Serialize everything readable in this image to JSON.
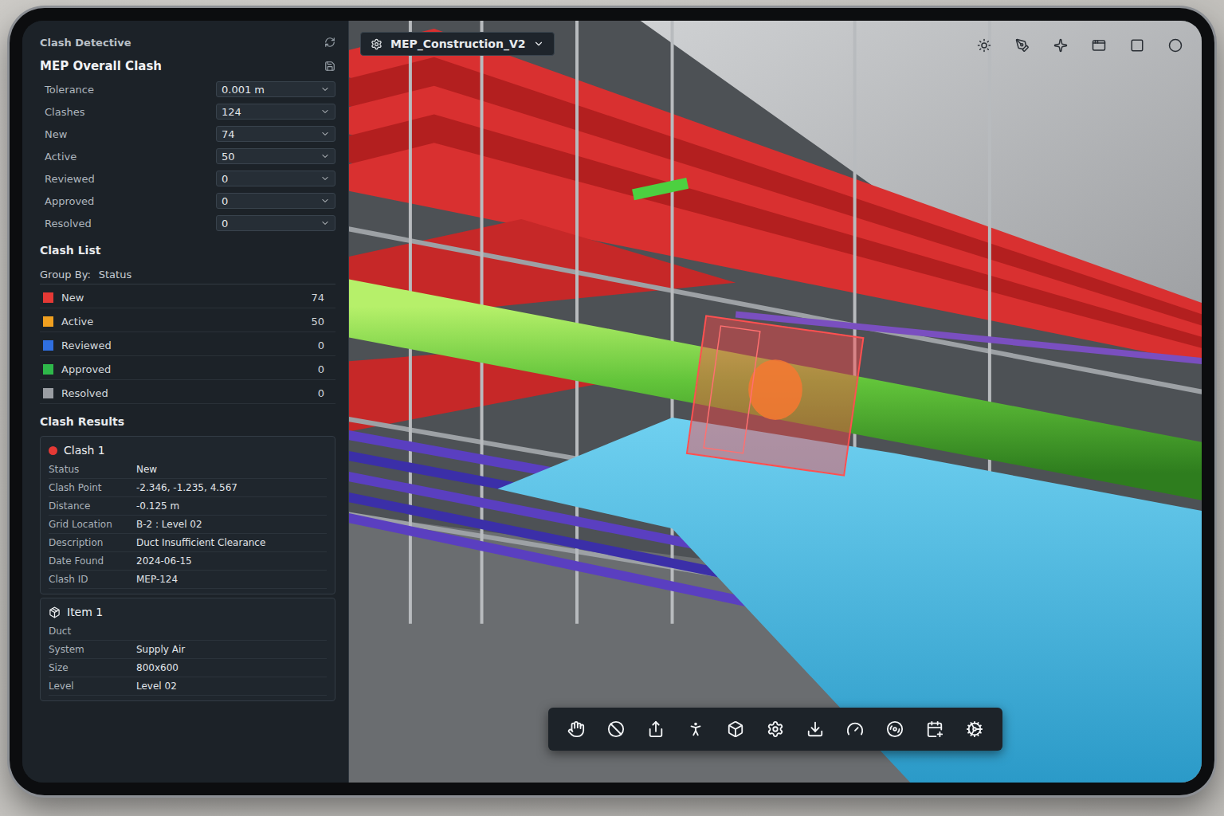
{
  "panel": {
    "title": "Clash Detective",
    "test_name": "MEP Overall Clash",
    "summary": [
      {
        "label": "Tolerance",
        "value": "0.001 m"
      },
      {
        "label": "Clashes",
        "value": "124"
      },
      {
        "label": "New",
        "value": "74"
      },
      {
        "label": "Active",
        "value": "50"
      },
      {
        "label": "Reviewed",
        "value": "0"
      },
      {
        "label": "Approved",
        "value": "0"
      },
      {
        "label": "Resolved",
        "value": "0"
      }
    ],
    "clash_list": {
      "title": "Clash List",
      "group_by_label": "Group By:",
      "group_by": "Status",
      "statuses": [
        {
          "label": "New",
          "count": "74",
          "color": "#e53935"
        },
        {
          "label": "Active",
          "count": "50",
          "color": "#f0a020"
        },
        {
          "label": "Reviewed",
          "count": "0",
          "color": "#2f6fe0"
        },
        {
          "label": "Approved",
          "count": "0",
          "color": "#2eb84a"
        },
        {
          "label": "Resolved",
          "count": "0",
          "color": "#9a9ea3"
        }
      ]
    },
    "clash_results": {
      "title": "Clash Results",
      "clash": {
        "name": "Clash 1",
        "color": "#e53935",
        "fields": [
          {
            "label": "Status",
            "value": "New"
          },
          {
            "label": "Clash Point",
            "value": "-2.346, -1.235, 4.567"
          },
          {
            "label": "Distance",
            "value": "-0.125 m"
          },
          {
            "label": "Grid Location",
            "value": "B-2 : Level 02"
          },
          {
            "label": "Description",
            "value": "Duct Insufficient Clearance"
          },
          {
            "label": "Date Found",
            "value": "2024-06-15"
          },
          {
            "label": "Clash ID",
            "value": "MEP-124"
          }
        ]
      }
    },
    "item": {
      "title": "Item 1",
      "category": "Duct",
      "fields": [
        {
          "label": "System",
          "value": "Supply Air"
        },
        {
          "label": "Size",
          "value": "800x600"
        },
        {
          "label": "Level",
          "value": "Level 02"
        }
      ]
    }
  },
  "viewport": {
    "model": "MEP_Construction_V2"
  }
}
